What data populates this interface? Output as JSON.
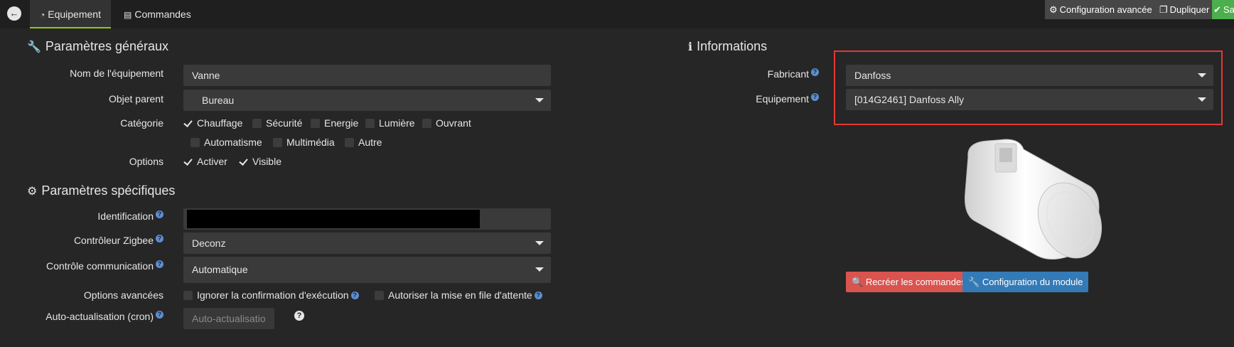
{
  "colors": {
    "accent": "#94ca02",
    "danger": "#d9534f",
    "primary": "#337ab7",
    "highlight": "#e53935",
    "success": "#4cae4c"
  },
  "topbar": {
    "back_icon": "arrow-circle-left-icon",
    "tabs": [
      {
        "label": "Equipement",
        "icon": "tachometer-icon",
        "active": true
      },
      {
        "label": "Commandes",
        "icon": "list-alt-icon",
        "active": false
      }
    ],
    "advanced_config": "Configuration avancée",
    "duplicate": "Dupliquer",
    "save": "Sa"
  },
  "general": {
    "title": "Paramètres généraux",
    "name_label": "Nom de l'équipement",
    "name_value": "Vanne",
    "parent_label": "Objet parent",
    "parent_value": "Bureau",
    "category_label": "Catégorie",
    "categories": [
      {
        "label": "Chauffage",
        "checked": true
      },
      {
        "label": "Sécurité",
        "checked": false
      },
      {
        "label": "Energie",
        "checked": false
      },
      {
        "label": "Lumière",
        "checked": false
      },
      {
        "label": "Ouvrant",
        "checked": false
      },
      {
        "label": "Automatisme",
        "checked": false
      },
      {
        "label": "Multimédia",
        "checked": false
      },
      {
        "label": "Autre",
        "checked": false
      }
    ],
    "options_label": "Options",
    "options": [
      {
        "label": "Activer",
        "checked": true
      },
      {
        "label": "Visible",
        "checked": true
      }
    ]
  },
  "specific": {
    "title": "Paramètres spécifiques",
    "identification_label": "Identification",
    "controller_label": "Contrôleur Zigbee",
    "controller_value": "Deconz",
    "comm_label": "Contrôle communication",
    "comm_value": "Automatique",
    "adv_options_label": "Options avancées",
    "ignore_confirm": "Ignorer la confirmation d'exécution",
    "allow_queue": "Autoriser la mise en file d'attente",
    "cron_label": "Auto-actualisation (cron)",
    "cron_placeholder": "Auto-actualisatio"
  },
  "info": {
    "title": "Informations",
    "manufacturer_label": "Fabricant",
    "manufacturer_value": "Danfoss",
    "device_label": "Equipement",
    "device_value": "[014G2461] Danfoss Ally",
    "recreate_button": "Recréer les commandes",
    "module_config_button": "Configuration du module"
  }
}
